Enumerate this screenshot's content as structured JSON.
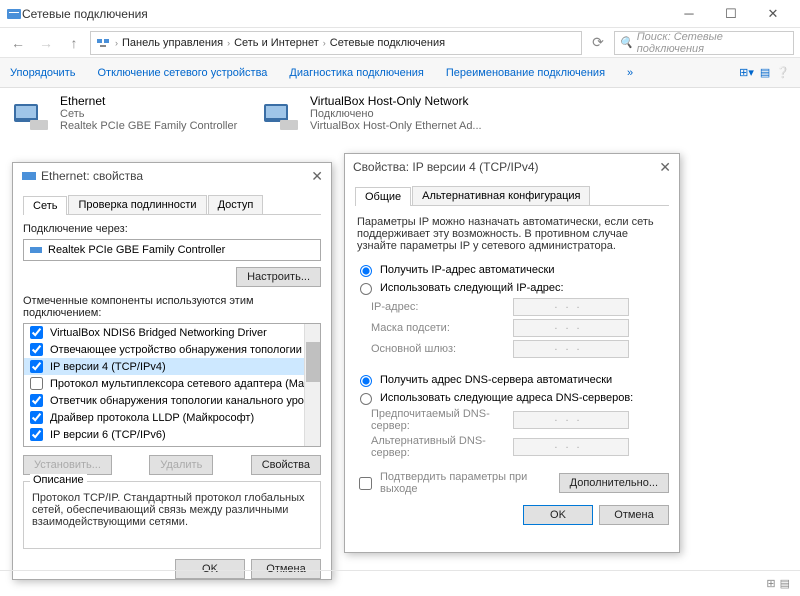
{
  "window": {
    "title": "Сетевые подключения"
  },
  "breadcrumb": {
    "a": "Панель управления",
    "b": "Сеть и Интернет",
    "c": "Сетевые подключения"
  },
  "search": {
    "placeholder": "Поиск: Сетевые подключения"
  },
  "cmdbar": {
    "arrange": "Упорядочить",
    "disable": "Отключение сетевого устройства",
    "diag": "Диагностика подключения",
    "rename": "Переименование подключения"
  },
  "conn1": {
    "name": "Ethernet",
    "status": "Сеть",
    "adapter": "Realtek PCIe GBE Family Controller"
  },
  "conn2": {
    "name": "VirtualBox Host-Only Network",
    "status": "Подключено",
    "adapter": "VirtualBox Host-Only Ethernet Ad..."
  },
  "eth_dlg": {
    "title": "Ethernet: свойства",
    "tab_net": "Сеть",
    "tab_auth": "Проверка подлинности",
    "tab_access": "Доступ",
    "connect_via": "Подключение через:",
    "nic": "Realtek PCIe GBE Family Controller",
    "configure": "Настроить...",
    "components_label": "Отмеченные компоненты используются этим подключением:",
    "components": [
      "VirtualBox NDIS6 Bridged Networking Driver",
      "Отвечающее устройство обнаружения топологии к",
      "IP версии 4 (TCP/IPv4)",
      "Протокол мультиплексора сетевого адаптера (Ма",
      "Ответчик обнаружения топологии канального уров",
      "Драйвер протокола LLDP (Майкрософт)",
      "IP версии 6 (TCP/IPv6)"
    ],
    "install": "Установить...",
    "remove": "Удалить",
    "props": "Свойства",
    "desc_title": "Описание",
    "desc": "Протокол TCP/IP. Стандартный протокол глобальных сетей, обеспечивающий связь между различными взаимодействующими сетями.",
    "ok": "OK",
    "cancel": "Отмена"
  },
  "ip_dlg": {
    "title": "Свойства: IP версии 4 (TCP/IPv4)",
    "tab_general": "Общие",
    "tab_alt": "Альтернативная конфигурация",
    "intro": "Параметры IP можно назначать автоматически, если сеть поддерживает эту возможность. В противном случае узнайте параметры IP у сетевого администратора.",
    "r_auto_ip": "Получить IP-адрес автоматически",
    "r_manual_ip": "Использовать следующий IP-адрес:",
    "f_ip": "IP-адрес:",
    "f_mask": "Маска подсети:",
    "f_gw": "Основной шлюз:",
    "r_auto_dns": "Получить адрес DNS-сервера автоматически",
    "r_manual_dns": "Использовать следующие адреса DNS-серверов:",
    "f_dns1": "Предпочитаемый DNS-сервер:",
    "f_dns2": "Альтернативный DNS-сервер:",
    "validate": "Подтвердить параметры при выходе",
    "advanced": "Дополнительно...",
    "ok": "OK",
    "cancel": "Отмена"
  },
  "ip_placeholder": "..."
}
